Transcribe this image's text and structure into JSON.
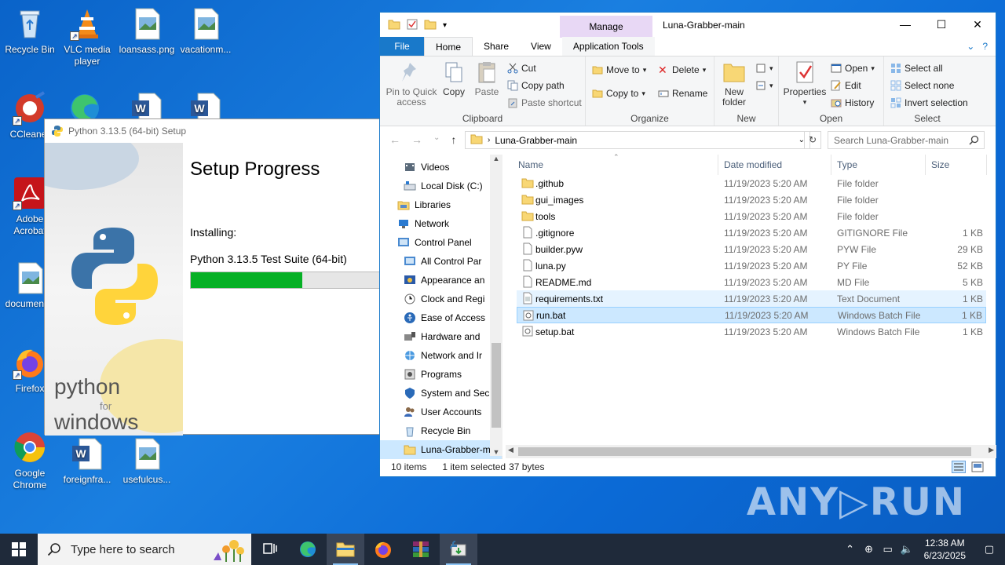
{
  "desktop": {
    "icons": [
      {
        "label": "Recycle Bin"
      },
      {
        "label": "VLC media player"
      },
      {
        "label": "loansass.png"
      },
      {
        "label": "vacationm..."
      },
      {
        "label": "CCleaner"
      },
      {
        "label": "Adobe Acrobat"
      },
      {
        "label": "document..."
      },
      {
        "label": "Firefox"
      },
      {
        "label": "Google Chrome"
      },
      {
        "label": "foreignfra..."
      },
      {
        "label": "usefulcus..."
      }
    ],
    "watermark": "ANY▷RUN"
  },
  "python_setup": {
    "title": "Python 3.13.5 (64-bit) Setup",
    "heading": "Setup Progress",
    "installing_label": "Installing:",
    "product": "Python 3.13.5 Test Suite (64-bit)",
    "progress": 0.55,
    "logo_text_1": "python",
    "logo_text_2": "for",
    "logo_text_3": "windows"
  },
  "explorer": {
    "title": "Luna-Grabber-main",
    "manage_tab": "Manage",
    "tabs": {
      "file": "File",
      "home": "Home",
      "share": "Share",
      "view": "View",
      "app_tools": "Application Tools"
    },
    "ribbon": {
      "clipboard": {
        "label": "Clipboard",
        "pin": "Pin to Quick access",
        "copy": "Copy",
        "paste": "Paste",
        "cut": "Cut",
        "copy_path": "Copy path",
        "paste_shortcut": "Paste shortcut"
      },
      "organize": {
        "label": "Organize",
        "move_to": "Move to",
        "copy_to": "Copy to",
        "delete": "Delete",
        "rename": "Rename"
      },
      "new": {
        "label": "New",
        "new_folder": "New folder"
      },
      "open": {
        "label": "Open",
        "properties": "Properties",
        "open": "Open",
        "edit": "Edit",
        "history": "History"
      },
      "select": {
        "label": "Select",
        "select_all": "Select all",
        "select_none": "Select none",
        "invert": "Invert selection"
      }
    },
    "address": {
      "path": "Luna-Grabber-main",
      "search_placeholder": "Search Luna-Grabber-main"
    },
    "nav": [
      {
        "label": "Videos"
      },
      {
        "label": "Local Disk (C:)"
      },
      {
        "label": "Libraries"
      },
      {
        "label": "Network"
      },
      {
        "label": "Control Panel"
      },
      {
        "label": "All Control Par"
      },
      {
        "label": "Appearance an"
      },
      {
        "label": "Clock and Regi"
      },
      {
        "label": "Ease of Access"
      },
      {
        "label": "Hardware and"
      },
      {
        "label": "Network and Ir"
      },
      {
        "label": "Programs"
      },
      {
        "label": "System and Sec"
      },
      {
        "label": "User Accounts"
      },
      {
        "label": "Recycle Bin"
      },
      {
        "label": "Luna-Grabber-m"
      }
    ],
    "columns": {
      "name": "Name",
      "date": "Date modified",
      "type": "Type",
      "size": "Size"
    },
    "files": [
      {
        "name": ".github",
        "date": "11/19/2023 5:20 AM",
        "type": "File folder",
        "size": ""
      },
      {
        "name": "gui_images",
        "date": "11/19/2023 5:20 AM",
        "type": "File folder",
        "size": ""
      },
      {
        "name": "tools",
        "date": "11/19/2023 5:20 AM",
        "type": "File folder",
        "size": ""
      },
      {
        "name": ".gitignore",
        "date": "11/19/2023 5:20 AM",
        "type": "GITIGNORE File",
        "size": "1 KB"
      },
      {
        "name": "builder.pyw",
        "date": "11/19/2023 5:20 AM",
        "type": "PYW File",
        "size": "29 KB"
      },
      {
        "name": "luna.py",
        "date": "11/19/2023 5:20 AM",
        "type": "PY File",
        "size": "52 KB"
      },
      {
        "name": "README.md",
        "date": "11/19/2023 5:20 AM",
        "type": "MD File",
        "size": "5 KB"
      },
      {
        "name": "requirements.txt",
        "date": "11/19/2023 5:20 AM",
        "type": "Text Document",
        "size": "1 KB"
      },
      {
        "name": "run.bat",
        "date": "11/19/2023 5:20 AM",
        "type": "Windows Batch File",
        "size": "1 KB"
      },
      {
        "name": "setup.bat",
        "date": "11/19/2023 5:20 AM",
        "type": "Windows Batch File",
        "size": "1 KB"
      }
    ],
    "status": {
      "items": "10 items",
      "selected": "1 item selected",
      "bytes": "37 bytes"
    }
  },
  "taskbar": {
    "search_placeholder": "Type here to search",
    "time": "12:38 AM",
    "date": "6/23/2025"
  }
}
